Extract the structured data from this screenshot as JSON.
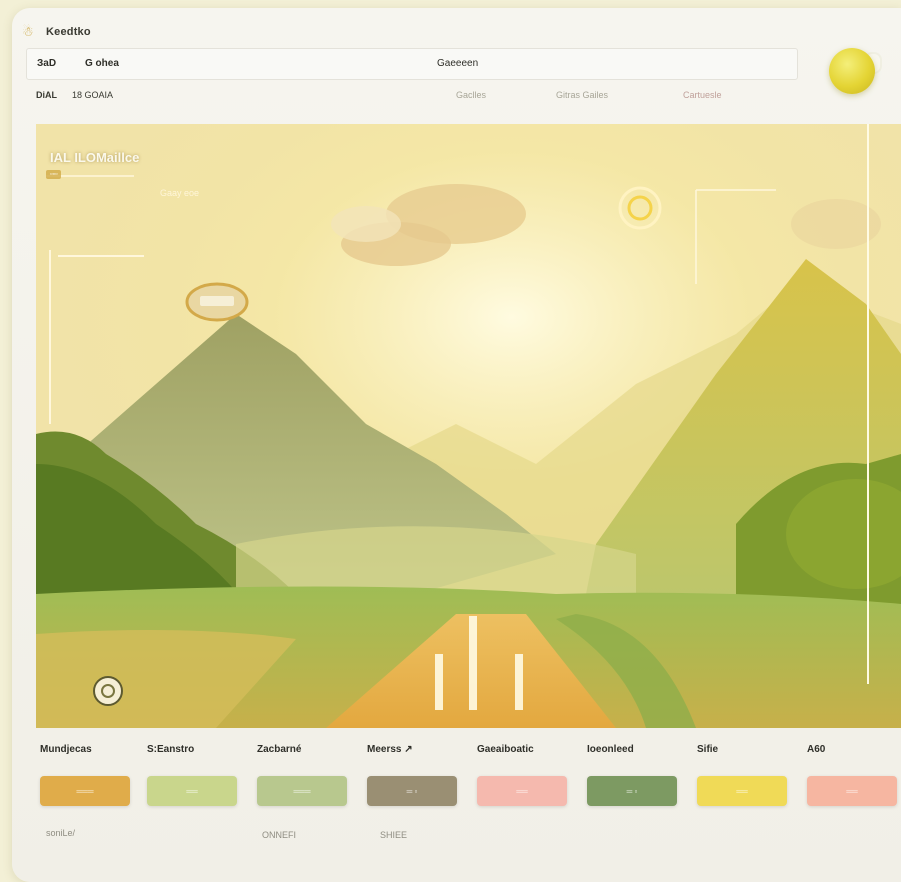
{
  "app": {
    "title": "Keedtko"
  },
  "toolbar": {
    "item_a": "ЗaD",
    "item_b": "G ohea",
    "item_c": "Gaeeeen"
  },
  "subbar": {
    "item_a": "DiAL",
    "item_b": "18 GOAIA",
    "item_c": "Gaclles",
    "item_d": "Gitras Gailes",
    "item_e": "Cartuesle"
  },
  "hero": {
    "title": "IAL ILOMaillce",
    "subtitle": "Gaay eoe"
  },
  "controls": [
    {
      "label": "Mundjecas",
      "color": "#e0ac4a"
    },
    {
      "label": "S:Eanstro",
      "color": "#c9d68c"
    },
    {
      "label": "Zacbarné",
      "color": "#b8c88e"
    },
    {
      "label": "Meerss ↗",
      "color": "#9a8f73"
    },
    {
      "label": "Gaeaiboatic",
      "color": "#f5b9ae"
    },
    {
      "label": "Ioeonleed",
      "color": "#7d9a62"
    },
    {
      "label": "Sifie",
      "color": "#f0da57"
    },
    {
      "label": "A60",
      "color": "#f6b6a1"
    }
  ],
  "footer": {
    "left": "soniLe/",
    "mid_a": "ONNEFI",
    "mid_b": "SHIEE"
  },
  "colors": {
    "accent": "#e4d434",
    "frame": "#f6f5ef"
  }
}
